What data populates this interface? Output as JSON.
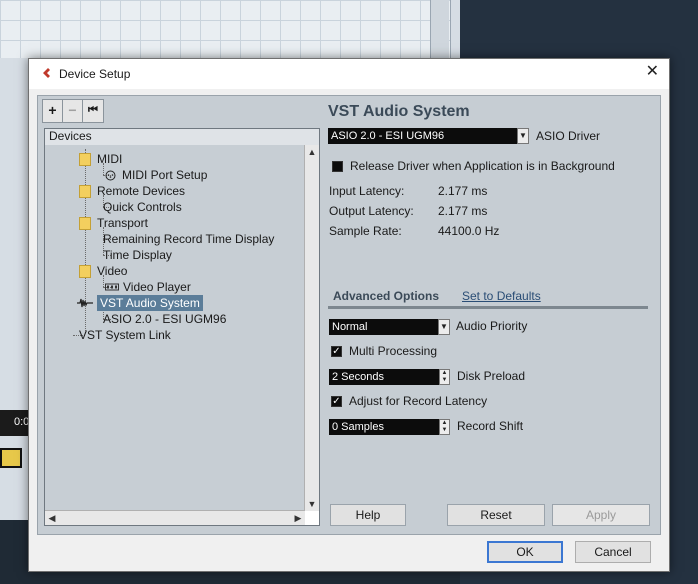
{
  "background": {
    "time_fragment": "0:0"
  },
  "window": {
    "title": "Device Setup",
    "close_glyph": "✕"
  },
  "toolbar": {
    "add": "+",
    "remove": "−",
    "reset": "⏮"
  },
  "tree": {
    "header": "Devices",
    "items": [
      {
        "label": "MIDI",
        "type": "folder"
      },
      {
        "label": "MIDI Port Setup",
        "type": "child-icon"
      },
      {
        "label": "Remote Devices",
        "type": "folder"
      },
      {
        "label": "Quick Controls",
        "type": "child"
      },
      {
        "label": "Transport",
        "type": "folder"
      },
      {
        "label": "Remaining Record Time Display",
        "type": "child"
      },
      {
        "label": "Time Display",
        "type": "child"
      },
      {
        "label": "Video",
        "type": "folder"
      },
      {
        "label": "Video Player",
        "type": "child-icon"
      },
      {
        "label": "VST Audio System",
        "type": "selected"
      },
      {
        "label": "ASIO 2.0 - ESI UGM96",
        "type": "child"
      },
      {
        "label": "VST System Link",
        "type": "root"
      }
    ]
  },
  "panel": {
    "title": "VST Audio System",
    "driver_value": "ASIO 2.0 - ESI UGM96",
    "driver_label": "ASIO Driver",
    "release_driver_label": "Release Driver when Application is in Background",
    "release_driver_checked": false,
    "input_latency_label": "Input Latency:",
    "input_latency_value": "2.177 ms",
    "output_latency_label": "Output Latency:",
    "output_latency_value": "2.177 ms",
    "sample_rate_label": "Sample Rate:",
    "sample_rate_value": "44100.0 Hz",
    "advanced_title": "Advanced Options",
    "set_defaults": "Set to Defaults",
    "audio_priority_value": "Normal",
    "audio_priority_label": "Audio Priority",
    "multi_processing_label": "Multi Processing",
    "multi_processing_checked": true,
    "disk_preload_value": "2 Seconds",
    "disk_preload_label": "Disk Preload",
    "adjust_latency_label": "Adjust for Record Latency",
    "adjust_latency_checked": true,
    "record_shift_value": "0 Samples",
    "record_shift_label": "Record Shift",
    "help": "Help",
    "reset": "Reset",
    "apply": "Apply"
  },
  "footer": {
    "ok": "OK",
    "cancel": "Cancel"
  },
  "colors": {
    "accent": "#3b77d2",
    "selection": "#5b7d99",
    "folder": "#f3cf5e"
  }
}
